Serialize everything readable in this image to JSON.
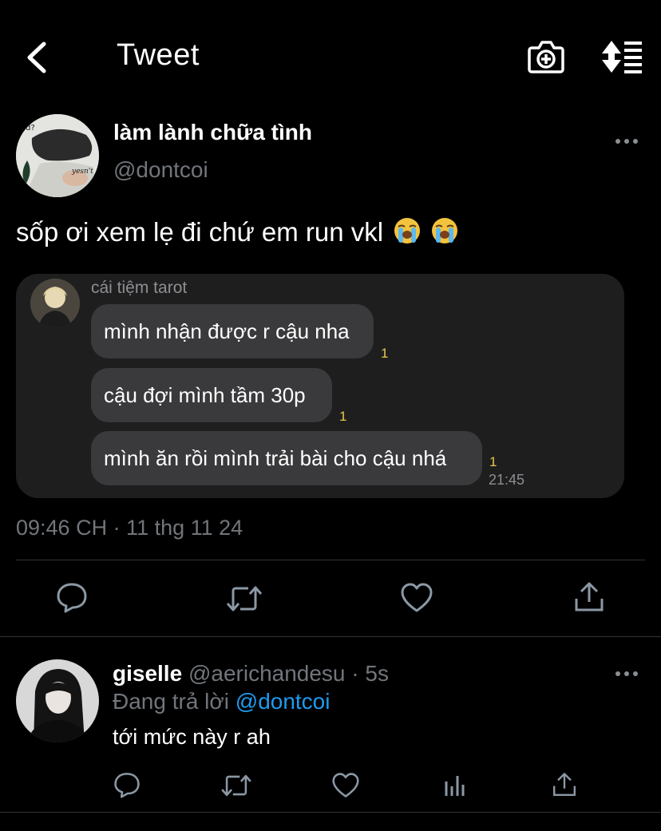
{
  "header": {
    "title": "Tweet",
    "back_icon": "chevron-left-icon",
    "camera_icon": "camera-plus-icon",
    "sort_icon": "sort-list-icon"
  },
  "tweet": {
    "author_name": "làm lành chữa tình",
    "author_handle": "@dontcoi",
    "text": "sốp ơi xem lẹ đi chứ em run vkl",
    "emojis": [
      "loudly-crying-face",
      "loudly-crying-face"
    ],
    "timestamp": "09:46 CH · 11 thg 11 24",
    "media": {
      "chat_name": "cái tiệm tarot",
      "messages": [
        {
          "text": "mình nhận được r cậu nha",
          "read_count": "1"
        },
        {
          "text": "cậu đợi mình tầm 30p",
          "read_count": "1"
        },
        {
          "text": "mình ăn rồi mình trải bài cho cậu nhá",
          "read_count": "1"
        }
      ],
      "time": "21:45",
      "avatar_text": [
        "od?",
        "yesn't"
      ]
    }
  },
  "actions": [
    "reply-icon",
    "retweet-icon",
    "like-icon",
    "share-icon"
  ],
  "reply": {
    "author_name": "giselle",
    "meta": "@aerichandesu · 5s",
    "replying_prefix": "Đang trả lời",
    "replying_to": "@dontcoi",
    "text": "tới mức này r ah",
    "actions": [
      "reply-icon",
      "retweet-icon",
      "like-icon",
      "analytics-icon",
      "share-icon"
    ]
  },
  "colors": {
    "background": "#000000",
    "text_primary": "#ffffff",
    "text_secondary": "#71767b",
    "link": "#1d9bf0",
    "bubble": "#3a3a3c",
    "card": "#1e1e1f",
    "divider": "#2f3336",
    "read_count": "#e6c84a"
  }
}
